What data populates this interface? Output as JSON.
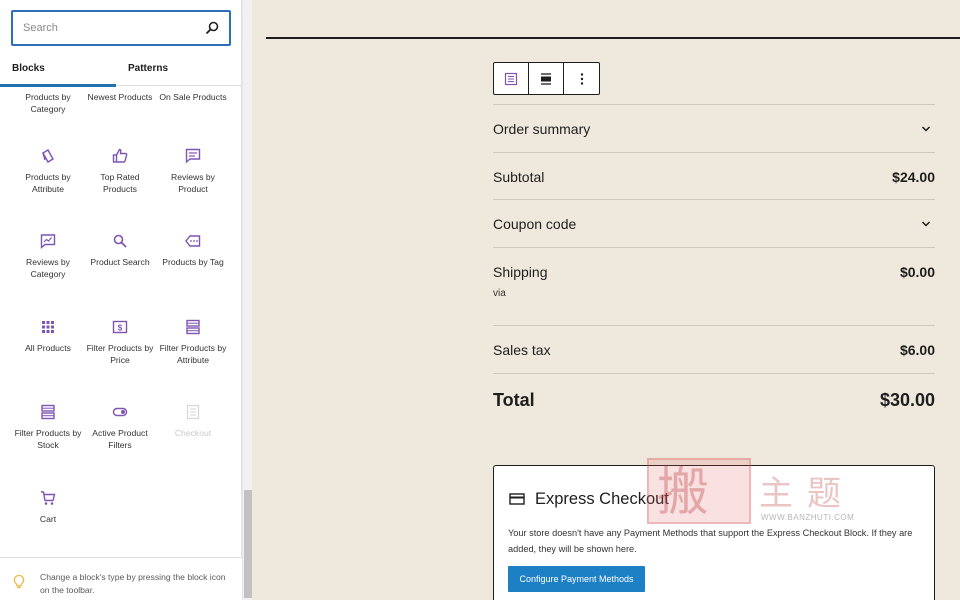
{
  "inserter": {
    "search_placeholder": "Search",
    "tabs": {
      "blocks": "Blocks",
      "patterns": "Patterns"
    },
    "blocks": [
      {
        "name": "products-by-category",
        "label": "Products by Category",
        "icon": "none"
      },
      {
        "name": "newest-products",
        "label": "Newest Products",
        "icon": "none"
      },
      {
        "name": "on-sale-products",
        "label": "On Sale Products",
        "icon": "none"
      },
      {
        "name": "products-by-attribute",
        "label": "Products by Attribute",
        "icon": "tag-icon"
      },
      {
        "name": "top-rated-products",
        "label": "Top Rated Products",
        "icon": "thumbs-up-icon"
      },
      {
        "name": "reviews-by-product",
        "label": "Reviews by Product",
        "icon": "comment-icon"
      },
      {
        "name": "reviews-by-category",
        "label": "Reviews by Category",
        "icon": "review-folder-icon"
      },
      {
        "name": "product-search",
        "label": "Product Search",
        "icon": "search-icon"
      },
      {
        "name": "products-by-tag",
        "label": "Products by Tag",
        "icon": "tag-outline-icon"
      },
      {
        "name": "all-products",
        "label": "All Products",
        "icon": "grid-icon"
      },
      {
        "name": "filter-products-by-price",
        "label": "Filter Products by Price",
        "icon": "price-icon"
      },
      {
        "name": "filter-products-by-attribute",
        "label": "Filter Products by Attribute",
        "icon": "attribute-filter-icon"
      },
      {
        "name": "filter-products-by-stock",
        "label": "Filter Products by Stock",
        "icon": "stock-filter-icon"
      },
      {
        "name": "active-product-filters",
        "label": "Active Product Filters",
        "icon": "toggle-icon"
      },
      {
        "name": "checkout",
        "label": "Checkout",
        "icon": "checkout-icon",
        "disabled": true
      },
      {
        "name": "cart",
        "label": "Cart",
        "icon": "cart-icon"
      }
    ],
    "tip": "Change a block's type by pressing the block icon on the toolbar."
  },
  "colors": {
    "accent": "#2271b1",
    "icon_purple": "#7f54b3",
    "canvas_bg": "#efe9dd",
    "button_blue": "#1d7fc4"
  },
  "order_summary": {
    "heading": "Order summary",
    "subtotal_label": "Subtotal",
    "subtotal_value": "$24.00",
    "coupon_label": "Coupon code",
    "shipping_label": "Shipping",
    "shipping_value": "$0.00",
    "shipping_via": "via",
    "tax_label": "Sales tax",
    "tax_value": "$6.00",
    "total_label": "Total",
    "total_value": "$30.00"
  },
  "express_checkout": {
    "title": "Express Checkout",
    "description": "Your store doesn't have any Payment Methods that support the Express Checkout Block. If they are added, they will be shown here.",
    "button_label": "Configure Payment Methods"
  },
  "watermark": {
    "url": "WWW.BANZHUTI.COM"
  }
}
